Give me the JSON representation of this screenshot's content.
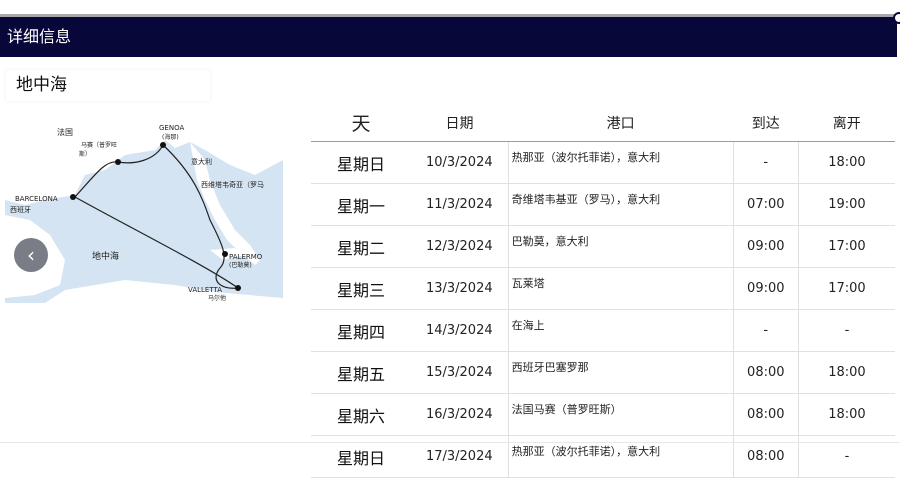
{
  "header": {
    "title": "详细信息"
  },
  "region": {
    "name": "地中海"
  },
  "map": {
    "labels": {
      "france": "法国",
      "marseille": "马赛（普罗旺",
      "marseille2": "斯）",
      "genoa": "GENOA",
      "genoa_cn": "(海那)",
      "italy": "意大利",
      "civitavecchia": "西维塔韦奇亚（罗马",
      "barcelona": "BARCELONA",
      "spain": "西班牙",
      "sea": "地中海",
      "palermo": "PALERMO",
      "palermo_cn": "(巴勒莫)",
      "valletta": "VALLETTA",
      "malta": "马尔他"
    },
    "colors": {
      "sea": "#d4e4f2",
      "land": "#ffffff",
      "route": "#222222"
    },
    "prev_icon": "chevron-left-icon",
    "prev_glyph": "‹"
  },
  "table": {
    "headers": {
      "day": "天",
      "date": "日期",
      "port": "港口",
      "arrive": "到达",
      "depart": "离开"
    },
    "rows": [
      {
        "day": "星期日",
        "date": "10/3/2024",
        "port": "热那亚（波尔托菲诺），意大利",
        "arrive": "-",
        "depart": "18:00"
      },
      {
        "day": "星期一",
        "date": "11/3/2024",
        "port": "奇维塔韦基亚（罗马），意大利",
        "arrive": "07:00",
        "depart": "19:00"
      },
      {
        "day": "星期二",
        "date": "12/3/2024",
        "port": "巴勒莫，意大利",
        "arrive": "09:00",
        "depart": "17:00"
      },
      {
        "day": "星期三",
        "date": "13/3/2024",
        "port": "瓦莱塔",
        "arrive": "09:00",
        "depart": "17:00"
      },
      {
        "day": "星期四",
        "date": "14/3/2024",
        "port": "在海上",
        "arrive": "-",
        "depart": "-"
      },
      {
        "day": "星期五",
        "date": "15/3/2024",
        "port": "西班牙巴塞罗那",
        "arrive": "08:00",
        "depart": "18:00"
      },
      {
        "day": "星期六",
        "date": "16/3/2024",
        "port": "法国马赛（普罗旺斯）",
        "arrive": "08:00",
        "depart": "18:00"
      },
      {
        "day": "星期日",
        "date": "17/3/2024",
        "port": "热那亚（波尔托菲诺），意大利",
        "arrive": "08:00",
        "depart": "-"
      }
    ]
  }
}
